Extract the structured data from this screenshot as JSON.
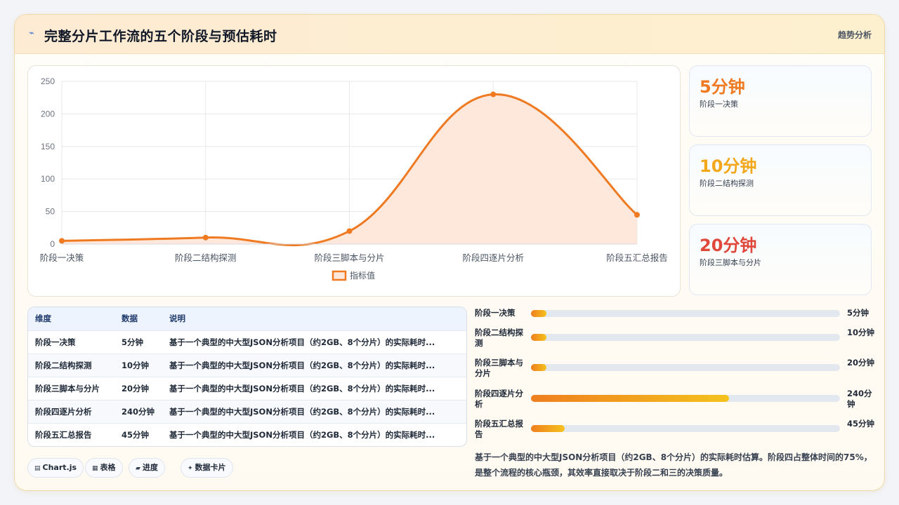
{
  "header": {
    "title": "完整分片工作流的五个阶段与预估耗时",
    "tag": "趋势分析"
  },
  "chart_data": {
    "type": "area",
    "categories": [
      "阶段一决策",
      "阶段二结构探测",
      "阶段三脚本与分片",
      "阶段四逐片分析",
      "阶段五汇总报告"
    ],
    "series": [
      {
        "name": "指标值",
        "values": [
          5,
          10,
          20,
          230,
          45
        ]
      }
    ],
    "ylim": [
      0,
      250
    ],
    "yticks": [
      0,
      50,
      100,
      150,
      200,
      250
    ],
    "grid": true,
    "legend": "bottom",
    "colors": {
      "line": "#f07a22",
      "fill": "#fde8db"
    }
  },
  "stats": [
    {
      "value": "5分钟",
      "label": "阶段一决策",
      "color": "#f07a22"
    },
    {
      "value": "10分钟",
      "label": "阶段二结构探测",
      "color": "#f3a71a"
    },
    {
      "value": "20分钟",
      "label": "阶段三脚本与分片",
      "color": "#e0483c"
    }
  ],
  "table": {
    "headers": [
      "维度",
      "数据",
      "说明"
    ],
    "rows": [
      [
        "阶段一决策",
        "5分钟",
        "基于一个典型的中大型JSON分析项目（约2GB、8个分片）的实际耗时..."
      ],
      [
        "阶段二结构探测",
        "10分钟",
        "基于一个典型的中大型JSON分析项目（约2GB、8个分片）的实际耗时..."
      ],
      [
        "阶段三脚本与分片",
        "20分钟",
        "基于一个典型的中大型JSON分析项目（约2GB、8个分片）的实际耗时..."
      ],
      [
        "阶段四逐片分析",
        "240分钟",
        "基于一个典型的中大型JSON分析项目（约2GB、8个分片）的实际耗时..."
      ],
      [
        "阶段五汇总报告",
        "45分钟",
        "基于一个典型的中大型JSON分析项目（约2GB、8个分片）的实际耗时..."
      ]
    ]
  },
  "chips": [
    {
      "icon": "▤",
      "icon_name": "chart-icon",
      "label": "Chart.js"
    },
    {
      "icon": "▦",
      "icon_name": "table-icon",
      "label": "表格"
    },
    {
      "icon": "▰",
      "icon_name": "progress-icon",
      "label": "进度"
    },
    {
      "icon": "✦",
      "icon_name": "card-icon",
      "label": "数据卡片"
    }
  ],
  "progress": [
    {
      "label": "阶段一决策",
      "value": "5分钟",
      "fraction": 0.05
    },
    {
      "label": "阶段二结构探测",
      "value": "10分钟",
      "fraction": 0.05
    },
    {
      "label": "阶段三脚本与分片",
      "value": "20分钟",
      "fraction": 0.05
    },
    {
      "label": "阶段四逐片分析",
      "value": "240分钟",
      "fraction": 0.64
    },
    {
      "label": "阶段五汇总报告",
      "value": "45分钟",
      "fraction": 0.11
    }
  ],
  "note": "基于一个典型的中大型JSON分析项目（约2GB、8个分片）的实际耗时估算。阶段四占整体时间的75%，是整个流程的核心瓶颈，其效率直接取决于阶段二和三的决策质量。"
}
